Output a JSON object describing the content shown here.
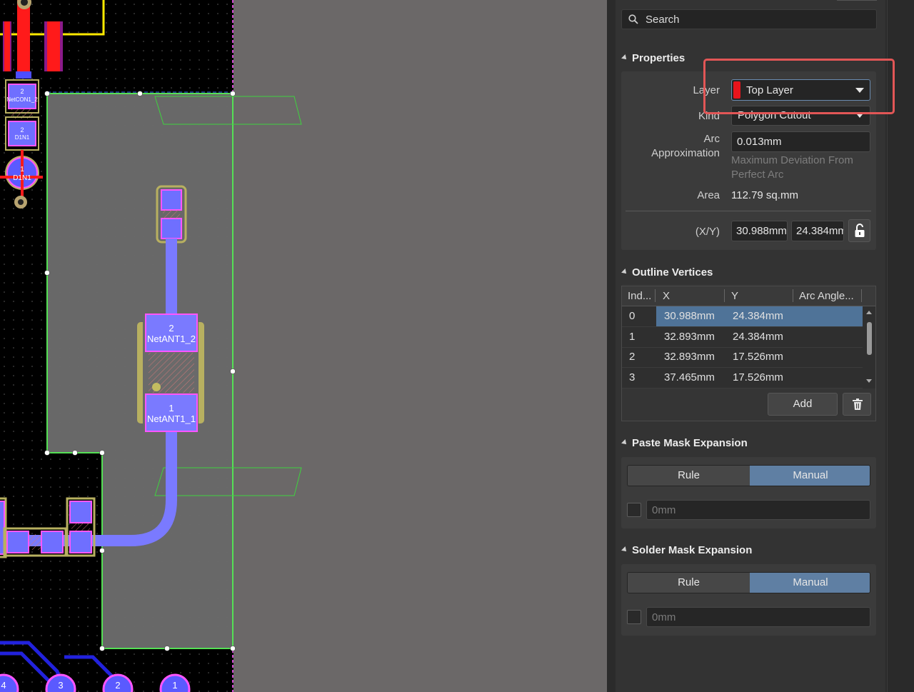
{
  "search": {
    "placeholder": "Search"
  },
  "properties": {
    "title": "Properties",
    "layer_label": "Layer",
    "layer_value": "Top Layer",
    "layer_color": "#e8141c",
    "kind_label": "Kind",
    "kind_value": "Polygon Cutout",
    "arc_label_1": "Arc",
    "arc_label_2": "Approximation",
    "arc_value": "0.013mm",
    "arc_hint_1": "Maximum Deviation From",
    "arc_hint_2": "Perfect Arc",
    "area_label": "Area",
    "area_value": "112.79 sq.mm",
    "xy_label": "(X/Y)",
    "x_value": "30.988mm",
    "y_value": "24.384mm"
  },
  "outline": {
    "title": "Outline Vertices",
    "columns": [
      "Ind...",
      "X",
      "Y",
      "Arc Angle..."
    ],
    "rows": [
      {
        "index": "0",
        "x": "30.988mm",
        "y": "24.384mm"
      },
      {
        "index": "1",
        "x": "32.893mm",
        "y": "24.384mm"
      },
      {
        "index": "2",
        "x": "32.893mm",
        "y": "17.526mm"
      },
      {
        "index": "3",
        "x": "37.465mm",
        "y": "17.526mm"
      }
    ],
    "add_label": "Add"
  },
  "paste": {
    "title": "Paste Mask Expansion",
    "rule": "Rule",
    "manual": "Manual",
    "value": "0mm"
  },
  "solder": {
    "title": "Solder Mask Expansion",
    "rule": "Rule",
    "manual": "Manual",
    "value": "0mm"
  },
  "pcb": {
    "pad_labels": {
      "p2_num": "2",
      "p2_net": "NetANT1_2",
      "p1_num": "1",
      "p1_net": "NetANT1_1",
      "c1_num": "2",
      "c1_net": "NetCON1_2",
      "d1_num": "2",
      "d1_net": "D1N1",
      "u1_num": "1",
      "u1_net": "D1N1",
      "b0_num": "4",
      "b1_num": "3",
      "b2_num": "2",
      "b3_num": "1"
    }
  }
}
